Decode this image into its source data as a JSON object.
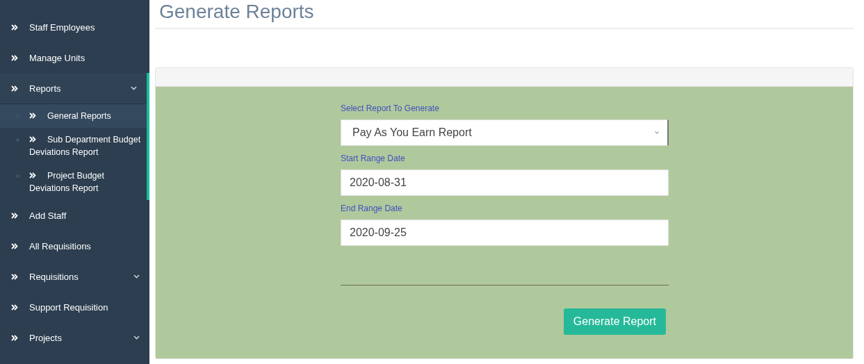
{
  "sidebar": {
    "items": [
      {
        "kind": "link",
        "label": "Staff Employees"
      },
      {
        "kind": "link",
        "label": "Manage Units"
      },
      {
        "kind": "group",
        "label": "Reports",
        "expanded": true,
        "children": [
          {
            "label": "General Reports",
            "selected": true
          },
          {
            "label": "Sub Department Budget Deviations Report",
            "selected": false
          },
          {
            "label": "Project Budget Deviations Report",
            "selected": false
          }
        ]
      },
      {
        "kind": "link",
        "label": "Add Staff"
      },
      {
        "kind": "link",
        "label": "All Requisitions"
      },
      {
        "kind": "group",
        "label": "Requisitions",
        "expanded": false
      },
      {
        "kind": "link",
        "label": "Support Requisition"
      },
      {
        "kind": "group",
        "label": "Projects",
        "expanded": false
      }
    ]
  },
  "page": {
    "title": "Generate Reports"
  },
  "form": {
    "fields": [
      {
        "kind": "select",
        "label": "Select Report To Generate",
        "value": "Pay As You Earn Report"
      },
      {
        "kind": "text",
        "label": "Start Range Date",
        "value": "2020-08-31"
      },
      {
        "kind": "text",
        "label": "End Range Date",
        "value": "2020-09-25"
      }
    ],
    "submit": "Generate Report"
  }
}
